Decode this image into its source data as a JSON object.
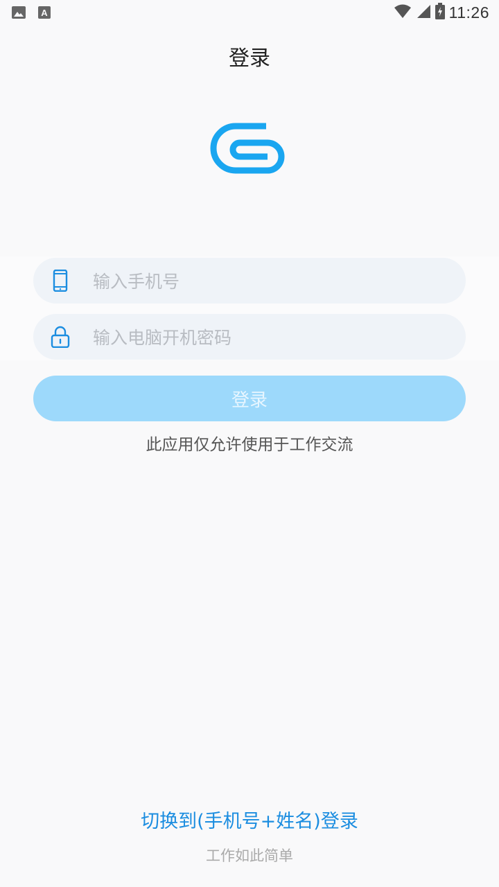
{
  "status_bar": {
    "time": "11:26",
    "left_icons": [
      "image-icon",
      "a-icon"
    ],
    "right_icons": [
      "wifi-icon",
      "signal-icon",
      "battery-icon"
    ]
  },
  "header": {
    "title": "登录"
  },
  "form": {
    "phone_placeholder": "输入手机号",
    "password_placeholder": "输入电脑开机密码",
    "login_label": "登录"
  },
  "notice": "此应用仅允许使用于工作交流",
  "footer": {
    "switch_label": "切换到(手机号+姓名)登录",
    "slogan": "工作如此简单"
  },
  "colors": {
    "accent": "#1b8de0",
    "logo": "#1aa6f0",
    "button_disabled": "#9dd9fb"
  }
}
